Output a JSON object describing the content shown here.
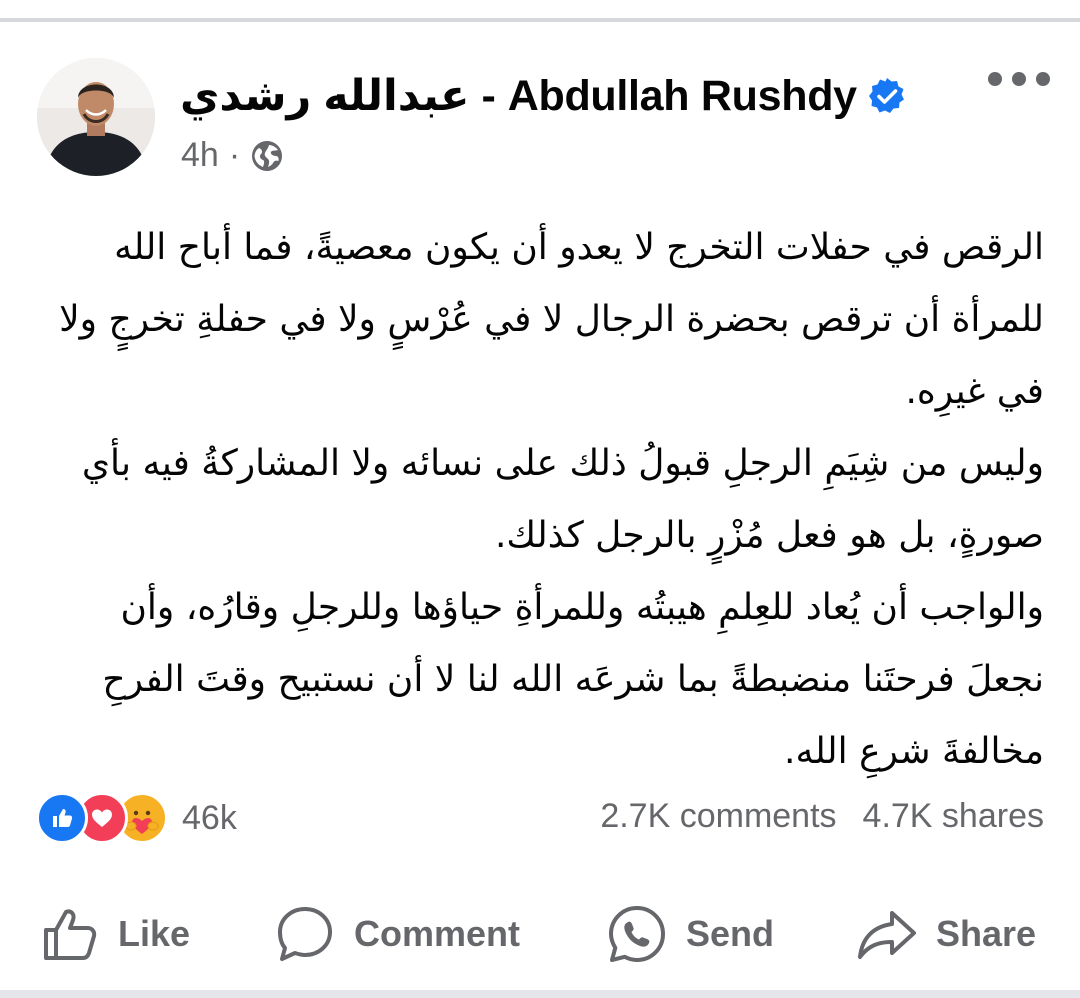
{
  "post": {
    "author": "عبدالله رشدي - Abdullah Rushdy",
    "time": "4h",
    "separator": "·",
    "privacy_icon": "globe-icon",
    "verified_icon": "verified-badge-icon",
    "more_icon": "more-options-icon",
    "body": [
      "الرقص في حفلات التخرج لا يعدو أن يكون معصيةً، فما أباح الله للمرأة أن ترقص بحضرة الرجال لا في عُرْسٍ ولا في حفلةِ تخرجٍ ولا في غيرِه.",
      "وليس من شِيَمِ الرجلِ قبولُ ذلك على نسائه ولا المشاركةُ فيه بأي صورةٍ، بل هو فعل مُزْرٍ بالرجل كذلك.",
      "والواجب أن يُعاد للعِلمِ هيبتُه وللمرأةِ حياؤها وللرجلِ وقارُه، وأن نجعلَ فرحتَنا منضبطةً بما شرعَه الله لنا لا أن نستبيح وقتَ الفرحِ مخالفةَ شرعِ الله."
    ]
  },
  "reactions": {
    "icons": [
      "like-reaction-icon",
      "love-reaction-icon",
      "care-reaction-icon"
    ],
    "count": "46k"
  },
  "stats": {
    "comments": "2.7K comments",
    "shares": "4.7K shares"
  },
  "actions": {
    "like": "Like",
    "comment": "Comment",
    "send": "Send",
    "share": "Share"
  },
  "colors": {
    "primary_text": "#050505",
    "secondary_text": "#65676b",
    "brand_blue": "#1877f2",
    "love_red": "#f33e58",
    "care_yellow": "#f7b125"
  }
}
